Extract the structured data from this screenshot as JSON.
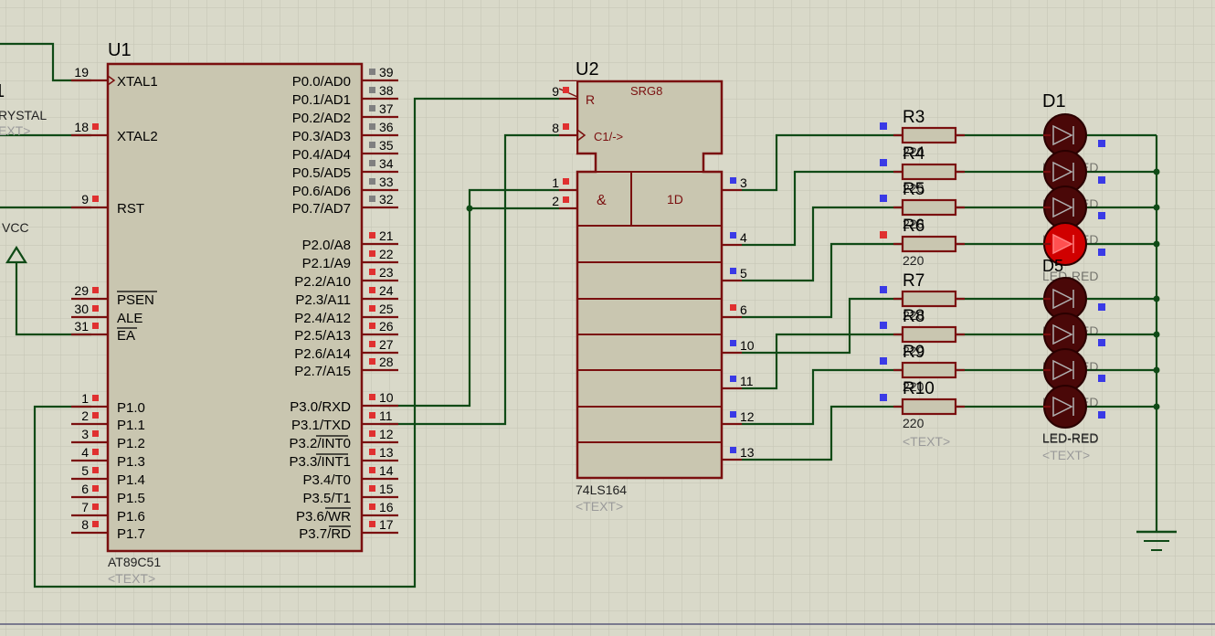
{
  "u1": {
    "ref": "U1",
    "part": "AT89C51",
    "text": "<TEXT>",
    "left_pins": [
      {
        "num": "19",
        "name": "XTAL1"
      },
      {
        "num": "18",
        "name": "XTAL2"
      },
      {
        "num": "9",
        "name": "RST"
      },
      {
        "num": "29",
        "name": "PSEN"
      },
      {
        "num": "30",
        "name": "ALE"
      },
      {
        "num": "31",
        "name": "EA"
      },
      {
        "num": "1",
        "name": "P1.0"
      },
      {
        "num": "2",
        "name": "P1.1"
      },
      {
        "num": "3",
        "name": "P1.2"
      },
      {
        "num": "4",
        "name": "P1.3"
      },
      {
        "num": "5",
        "name": "P1.4"
      },
      {
        "num": "6",
        "name": "P1.5"
      },
      {
        "num": "7",
        "name": "P1.6"
      },
      {
        "num": "8",
        "name": "P1.7"
      }
    ],
    "right_pins": [
      {
        "num": "39",
        "name": "P0.0/AD0"
      },
      {
        "num": "38",
        "name": "P0.1/AD1"
      },
      {
        "num": "37",
        "name": "P0.2/AD2"
      },
      {
        "num": "36",
        "name": "P0.3/AD3"
      },
      {
        "num": "35",
        "name": "P0.4/AD4"
      },
      {
        "num": "34",
        "name": "P0.5/AD5"
      },
      {
        "num": "33",
        "name": "P0.6/AD6"
      },
      {
        "num": "32",
        "name": "P0.7/AD7"
      },
      {
        "num": "21",
        "name": "P2.0/A8"
      },
      {
        "num": "22",
        "name": "P2.1/A9"
      },
      {
        "num": "23",
        "name": "P2.2/A10"
      },
      {
        "num": "24",
        "name": "P2.3/A11"
      },
      {
        "num": "25",
        "name": "P2.4/A12"
      },
      {
        "num": "26",
        "name": "P2.5/A13"
      },
      {
        "num": "27",
        "name": "P2.6/A14"
      },
      {
        "num": "28",
        "name": "P2.7/A15"
      },
      {
        "num": "10",
        "name": "P3.0/RXD"
      },
      {
        "num": "11",
        "name": "P3.1/TXD"
      },
      {
        "num": "12",
        "name": "P3.2/INT0"
      },
      {
        "num": "13",
        "name": "P3.3/INT1"
      },
      {
        "num": "14",
        "name": "P3.4/T0"
      },
      {
        "num": "15",
        "name": "P3.5/T1"
      },
      {
        "num": "16",
        "name": "P3.6/WR"
      },
      {
        "num": "17",
        "name": "P3.7/RD"
      }
    ]
  },
  "u2": {
    "ref": "U2",
    "part": "74LS164",
    "text": "<TEXT>",
    "block": "SRG8",
    "r_label": "R",
    "clk_label": "C1/->",
    "and_label": "&",
    "d_label": "1D",
    "in_pins": [
      "9",
      "8",
      "1",
      "2"
    ],
    "out_pins": [
      "3",
      "4",
      "5",
      "6",
      "10",
      "11",
      "12",
      "13"
    ]
  },
  "crystal": {
    "ref_fragment": "1",
    "name_fragment": "RYSTAL",
    "text_fragment": "EXT>"
  },
  "vcc_label": "VCC",
  "resistors": [
    {
      "ref": "R3",
      "value": "220"
    },
    {
      "ref": "R4",
      "value": "220"
    },
    {
      "ref": "R5",
      "value": "220"
    },
    {
      "ref": "R6",
      "value": "220"
    },
    {
      "ref": "R7",
      "value": "220"
    },
    {
      "ref": "R8",
      "value": "220"
    },
    {
      "ref": "R9",
      "value": "220"
    },
    {
      "ref": "R10",
      "value": "220"
    }
  ],
  "resistor_text": "<TEXT>",
  "leds": {
    "first_ref": "D1",
    "d5_ref": "D5",
    "part": "LED-RED",
    "text": "<TEXT>",
    "lit_index": 3,
    "count": 8
  },
  "colors": {
    "background": "#d9d9c9",
    "grid": "#c4c4b4",
    "wire": "#0f4a16",
    "component_body": "#c9c6b0",
    "component_outline": "#7a0f0f",
    "pin_red": "#e03030",
    "pin_blue": "#3a3ae6",
    "pin_grey": "#808080",
    "led_off": "#4a0808",
    "led_on": "#d00000"
  }
}
